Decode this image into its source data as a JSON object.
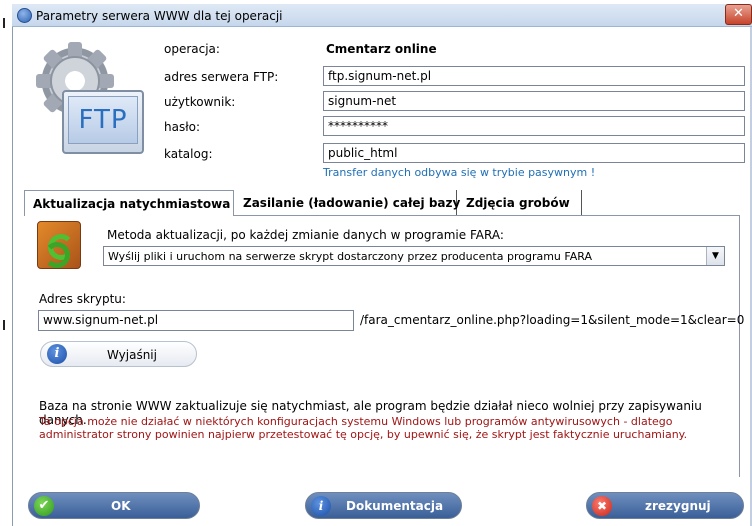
{
  "window": {
    "title": "Parametry serwera WWW dla tej operacji",
    "close_glyph": "✕"
  },
  "logo": {
    "screen_text": "FTP"
  },
  "form": {
    "operation_label": "operacja:",
    "operation_value": "Cmentarz online",
    "ftp_label": "adres serwera FTP:",
    "ftp_value": "ftp.signum-net.pl",
    "user_label": "użytkownik:",
    "user_value": "signum-net",
    "password_label": "hasło:",
    "password_value": "**********",
    "dir_label": "katalog:",
    "dir_value": "public_html",
    "passive_note": "Transfer danych odbywa się w trybie pasywnym !"
  },
  "tabs": [
    {
      "label": "Aktualizacja natychmiastowa"
    },
    {
      "label": "Zasilanie (ładowanie) całej bazy"
    },
    {
      "label": "Zdjęcia grobów"
    }
  ],
  "panel": {
    "method_label": "Metoda aktualizacji, po każdej zmianie danych w programie FARA:",
    "method_selected": "Wyślij pliki i uruchom na serwerze skrypt dostarczony przez producenta programu FARA",
    "script_label": "Adres skryptu:",
    "script_value": "www.signum-net.pl",
    "script_suffix": "/fara_cmentarz_online.php?loading=1&silent_mode=1&clear=0",
    "explain_label": "Wyjaśnij",
    "info_text": "Baza na stronie WWW zaktualizuje się natychmiast, ale program będzie działał nieco wolniej przy zapisywaniu danych.",
    "warn_text": "Ta opcja może nie działać w niektórych konfiguracjach systemu Windows lub programów antywirusowych - dlatego administrator strony powinien najpierw przetestować tę opcję, by upewnić się, że skrypt jest faktycznie uruchamiany."
  },
  "buttons": {
    "ok": "OK",
    "docs": "Dokumentacja",
    "cancel": "zrezygnuj"
  },
  "icons": {
    "info": "i",
    "ok": "✔",
    "cancel": "✖",
    "dropdown": "▼"
  },
  "colors": {
    "accent": "#1f6fb6",
    "warning": "#a01616",
    "button": "#3a5f98"
  }
}
